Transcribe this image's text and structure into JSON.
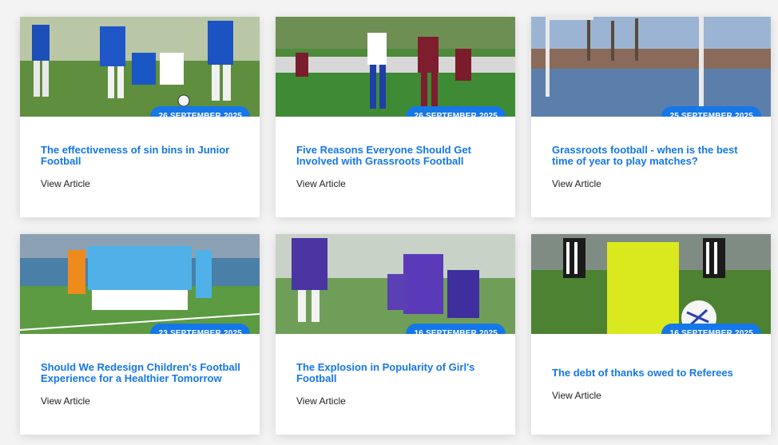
{
  "articles": [
    {
      "date": "26 SEPTEMBER 2025",
      "title": "The effectiveness of sin bins in Junior Football",
      "link_label": "View Article",
      "image": "youth-football-match-blue-kits"
    },
    {
      "date": "26 SEPTEMBER 2025",
      "title": "Five Reasons Everyone Should Get Involved with Grassroots Football",
      "link_label": "View Article",
      "image": "adult-grassroots-match-header"
    },
    {
      "date": "25 SEPTEMBER 2025",
      "title": "Grassroots football - when is the best time of year to play matches?",
      "link_label": "View Article",
      "image": "flooded-pitch-with-goalposts"
    },
    {
      "date": "23 SEPTEMBER 2025",
      "title": "Should We Redesign Children's Football Experience for a Healthier Tomorrow",
      "link_label": "View Article",
      "image": "children-team-huddle"
    },
    {
      "date": "16 SEPTEMBER 2025",
      "title": "The Explosion in Popularity of Girl's Football",
      "link_label": "View Article",
      "image": "girls-football-purple-kits"
    },
    {
      "date": "16 SEPTEMBER 2025",
      "title": "The debt of thanks owed to Referees",
      "link_label": "View Article",
      "image": "referee-holding-ball"
    }
  ],
  "colors": {
    "accent": "#1577e8",
    "card_bg": "#ffffff",
    "page_bg": "#f3f3f3",
    "text_dark": "#222222"
  }
}
